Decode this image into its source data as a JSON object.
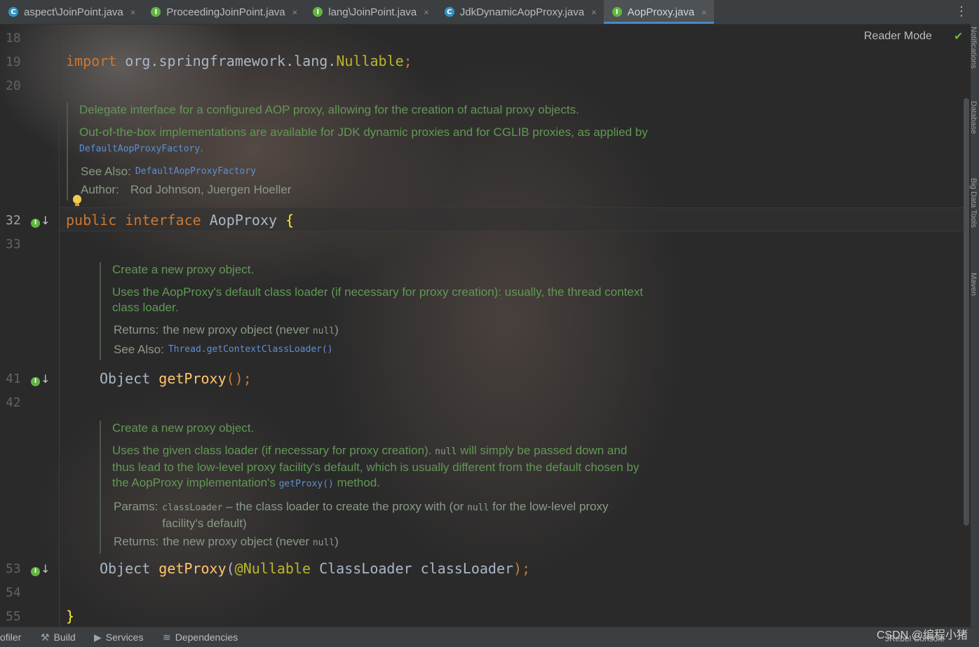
{
  "tabs": [
    {
      "icon": "C",
      "type": "class",
      "label": "aspect\\JoinPoint.java",
      "close": "×"
    },
    {
      "icon": "I",
      "type": "interface",
      "label": "ProceedingJoinPoint.java",
      "close": "×"
    },
    {
      "icon": "I",
      "type": "interface",
      "label": "lang\\JoinPoint.java",
      "close": "×"
    },
    {
      "icon": "C",
      "type": "class",
      "label": "JdkDynamicAopProxy.java",
      "close": "×"
    },
    {
      "icon": "I",
      "type": "interface",
      "label": "AopProxy.java",
      "close": "×",
      "active": true
    }
  ],
  "more_menu": "⋮",
  "reader_mode": {
    "label": "Reader Mode",
    "check": "✔"
  },
  "line_numbers": {
    "l18": "18",
    "l19": "19",
    "l20": "20",
    "l32": "32",
    "l33": "33",
    "l41": "41",
    "l42": "42",
    "l53": "53",
    "l54": "54",
    "l55": "55"
  },
  "code": {
    "import_kw": "import",
    "import_pkg": " org.springframework.lang.",
    "import_cls": "Nullable",
    "import_semi": ";",
    "public_kw": "public",
    "interface_kw": " interface",
    "iface_name": " AopProxy ",
    "open_brace": "{",
    "m1_type": "Object ",
    "m1_name": "getProxy",
    "m1_rest": "();",
    "m2_type": "Object ",
    "m2_name": "getProxy",
    "m2_paren": "(",
    "m2_ann": "@Nullable",
    "m2_params": " ClassLoader classLoader",
    "m2_end": ");",
    "close_brace": "}"
  },
  "doc_class": {
    "p1": "Delegate interface for a configured AOP proxy, allowing for the creation of actual proxy objects.",
    "p2a": "Out-of-the-box implementations are available for JDK dynamic proxies and for CGLIB proxies, as applied by ",
    "p2_link": "DefaultAopProxyFactory",
    "p2b": ".",
    "see_also_label": "See Also:",
    "see_also_link": "DefaultAopProxyFactory",
    "author_label": "Author:",
    "author_value": "Rod Johnson, Juergen Hoeller"
  },
  "doc_m1": {
    "p1": "Create a new proxy object.",
    "p2": "Uses the AopProxy's default class loader (if necessary for proxy creation): usually, the thread context class loader.",
    "returns_label": "Returns:",
    "returns_value": "the new proxy object (never ",
    "returns_null": "null",
    "returns_end": ")",
    "see_also_label": "See Also:",
    "see_also_link": "Thread.getContextClassLoader()"
  },
  "doc_m2": {
    "p1": "Create a new proxy object.",
    "p2a": "Uses the given class loader (if necessary for proxy creation). ",
    "p2_null": "null",
    "p2b": " will simply be passed down and thus lead to the low-level proxy facility's default, which is usually different from the default chosen by the AopProxy implementation's ",
    "p2_link": "getProxy()",
    "p2c": " method.",
    "params_label": "Params:",
    "params_code": "classLoader",
    "params_text_a": " – the class loader to create the proxy with (or ",
    "params_null": "null",
    "params_text_b": " for the low-level proxy facility's default)",
    "returns_label": "Returns:",
    "returns_value": "the new proxy object (never ",
    "returns_null": "null",
    "returns_end": ")"
  },
  "right_strip": [
    "Notifications",
    "Database",
    "Big Data Tools",
    "Maven"
  ],
  "bottom_bar": {
    "profiler": "ofiler",
    "build": "Build",
    "services": "Services",
    "dependencies": "Dependencies",
    "jrebel": "JRebel Console"
  },
  "watermark": "CSDN @编程小猪"
}
